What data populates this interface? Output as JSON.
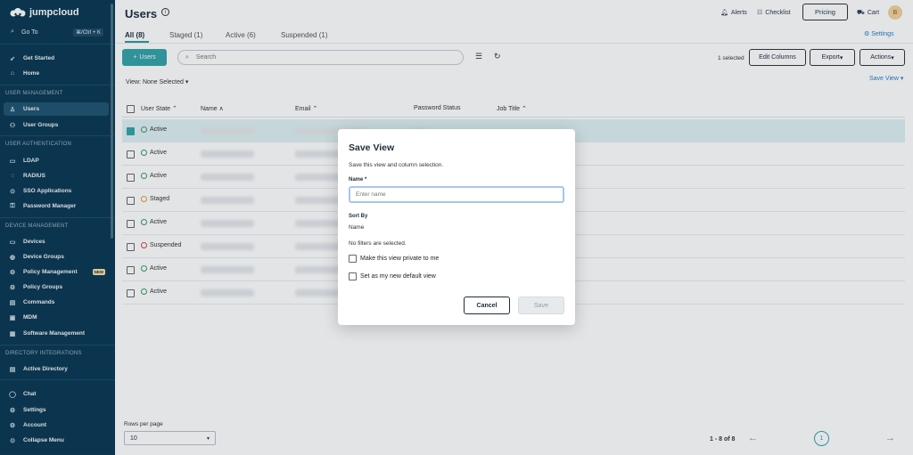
{
  "sidebar": {
    "brand": "jumpcloud",
    "goto": {
      "label": "Go To",
      "shortcut": "⌘/Ctrl + K"
    },
    "items": [
      {
        "label": "Get Started",
        "icon": "rocket-icon"
      },
      {
        "label": "Home",
        "icon": "home-icon"
      }
    ],
    "sections": [
      {
        "title": "USER MANAGEMENT",
        "items": [
          {
            "label": "Users",
            "icon": "user-icon",
            "active": true
          },
          {
            "label": "User Groups",
            "icon": "users-icon"
          }
        ]
      },
      {
        "title": "USER AUTHENTICATION",
        "items": [
          {
            "label": "LDAP",
            "icon": "ldap-icon"
          },
          {
            "label": "RADIUS",
            "icon": "radius-icon"
          },
          {
            "label": "SSO Applications",
            "icon": "sso-icon"
          },
          {
            "label": "Password Manager",
            "icon": "key-icon"
          }
        ]
      },
      {
        "title": "DEVICE MANAGEMENT",
        "items": [
          {
            "label": "Devices",
            "icon": "laptop-icon"
          },
          {
            "label": "Device Groups",
            "icon": "device-group-icon"
          },
          {
            "label": "Policy Management",
            "icon": "policy-icon",
            "badge": "NEW"
          },
          {
            "label": "Policy Groups",
            "icon": "policy-group-icon"
          },
          {
            "label": "Commands",
            "icon": "terminal-icon"
          },
          {
            "label": "MDM",
            "icon": "mdm-icon"
          },
          {
            "label": "Software Management",
            "icon": "software-icon"
          }
        ]
      },
      {
        "title": "DIRECTORY INTEGRATIONS",
        "items": [
          {
            "label": "Active Directory",
            "icon": "directory-icon"
          }
        ]
      }
    ],
    "bottom": [
      {
        "label": "Chat",
        "icon": "chat-icon"
      },
      {
        "label": "Settings",
        "icon": "gear-icon"
      },
      {
        "label": "Account",
        "icon": "account-icon"
      },
      {
        "label": "Collapse Menu",
        "icon": "collapse-icon"
      }
    ]
  },
  "header": {
    "title": "Users",
    "alerts": "Alerts",
    "checklist": "Checklist",
    "pricing": "Pricing",
    "cart": "Cart",
    "avatar_initial": "B"
  },
  "tabs": [
    {
      "label": "All (8)",
      "active": true
    },
    {
      "label": "Staged (1)"
    },
    {
      "label": "Active (6)"
    },
    {
      "label": "Suspended (1)"
    }
  ],
  "settings_link": "Settings",
  "toolbar": {
    "add_users": "Users",
    "search_placeholder": "Search",
    "selected_count": "1 selected",
    "edit_columns": "Edit Columns",
    "export": "Export",
    "actions": "Actions"
  },
  "view": {
    "label": "View:",
    "value": "None Selected"
  },
  "save_view_link": "Save View",
  "table": {
    "columns": [
      "User State",
      "Name",
      "Email",
      "Password Status",
      "Job Title"
    ],
    "rows": [
      {
        "state": "Active",
        "selected": true
      },
      {
        "state": "Active"
      },
      {
        "state": "Active"
      },
      {
        "state": "Staged"
      },
      {
        "state": "Active"
      },
      {
        "state": "Suspended"
      },
      {
        "state": "Active"
      },
      {
        "state": "Active"
      }
    ]
  },
  "pagination": {
    "rows_per_page_label": "Rows per page",
    "rows_per_page": "10",
    "range": "1 - 8 of 8",
    "current_page": "1"
  },
  "modal": {
    "title": "Save View",
    "description": "Save this view and column selection.",
    "name_label": "Name *",
    "name_placeholder": "Enter name",
    "sort_label": "Sort By",
    "sort_value": "Name",
    "filters_text": "No filters are selected.",
    "private_label": "Make this view private to me",
    "default_label": "Set as my new default view",
    "cancel": "Cancel",
    "save": "Save"
  },
  "colors": {
    "sidebar_bg": "#0b3853",
    "accent": "#35a3a8",
    "link": "#2a7ec4"
  }
}
